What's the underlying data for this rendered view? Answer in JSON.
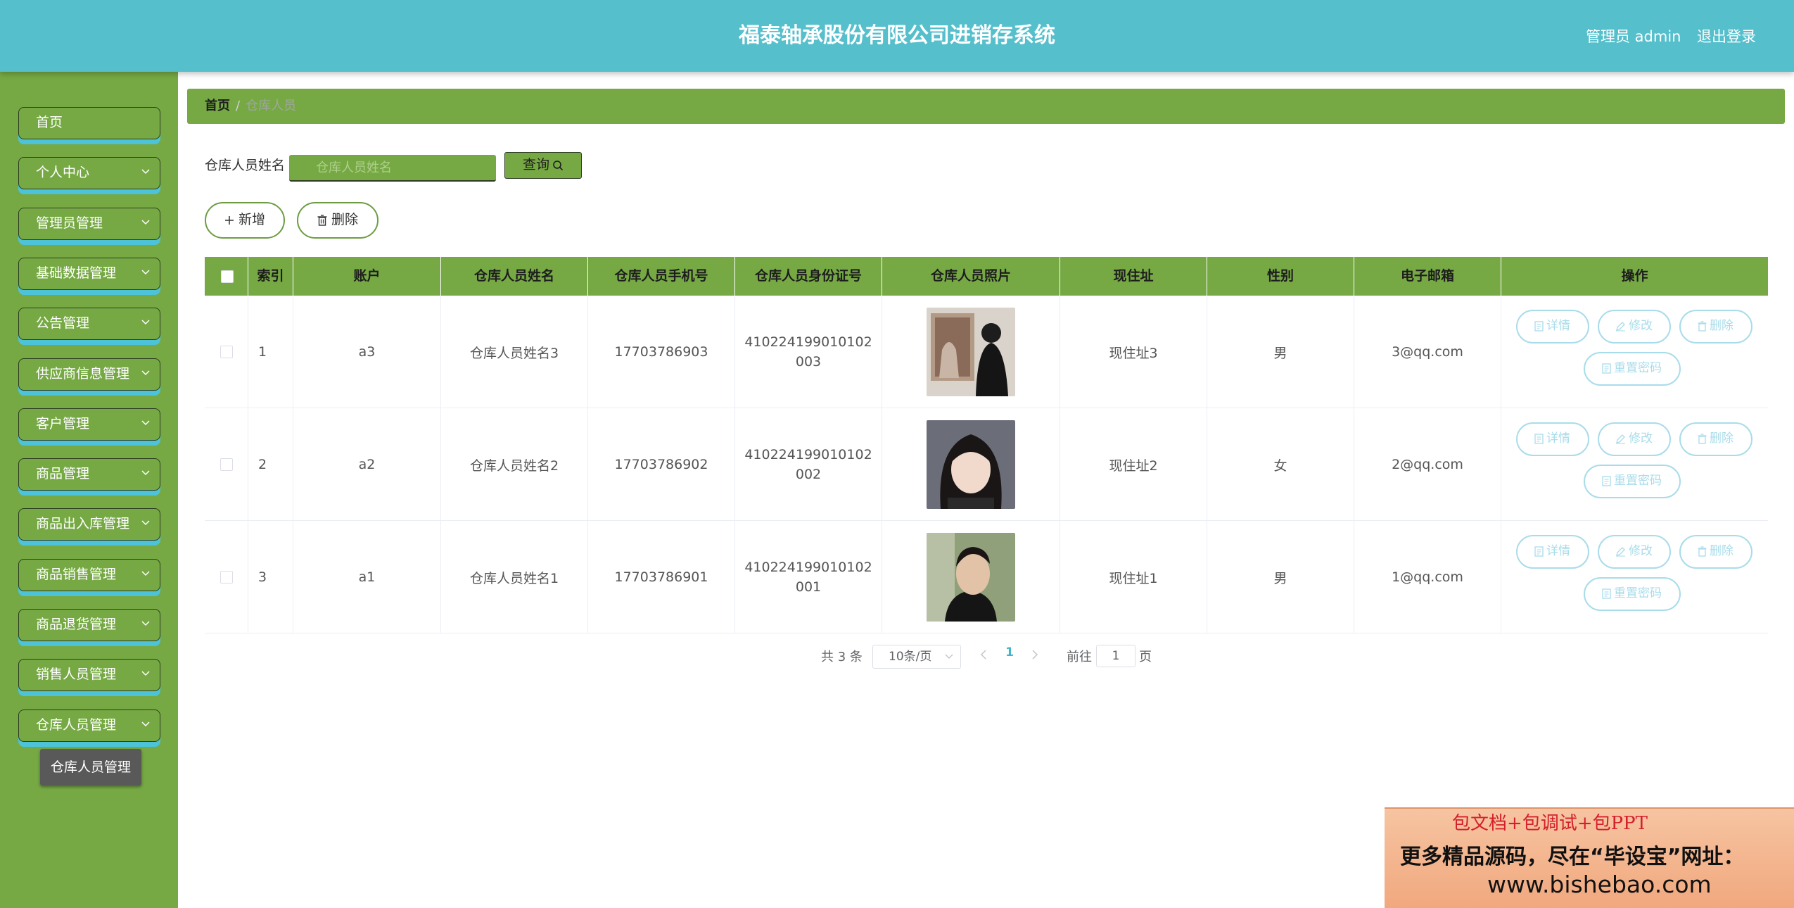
{
  "app": {
    "title": "福泰轴承股份有限公司进销存系统",
    "user_label": "管理员 admin",
    "logout_label": "退出登录"
  },
  "colors": {
    "header": "#55bfcc",
    "sidebar": "#76a944",
    "accent_shadow": "#4cc3d8",
    "op_button": "#a9dcea",
    "active_page": "#41b4c9"
  },
  "sidebar": {
    "items": [
      {
        "label": "首页",
        "has_chevron": false
      },
      {
        "label": "个人中心",
        "has_chevron": true
      },
      {
        "label": "管理员管理",
        "has_chevron": true
      },
      {
        "label": "基础数据管理",
        "has_chevron": true
      },
      {
        "label": "公告管理",
        "has_chevron": true
      },
      {
        "label": "供应商信息管理",
        "has_chevron": true
      },
      {
        "label": "客户管理",
        "has_chevron": true
      },
      {
        "label": "商品管理",
        "has_chevron": true
      },
      {
        "label": "商品出入库管理",
        "has_chevron": true
      },
      {
        "label": "商品销售管理",
        "has_chevron": true
      },
      {
        "label": "商品退货管理",
        "has_chevron": true
      },
      {
        "label": "销售人员管理",
        "has_chevron": true
      },
      {
        "label": "仓库人员管理",
        "has_chevron": true
      }
    ],
    "active_sub_item": "仓库人员管理"
  },
  "breadcrumb": {
    "home": "首页",
    "separator": "/",
    "current": "仓库人员"
  },
  "search": {
    "label": "仓库人员姓名",
    "placeholder": "仓库人员姓名",
    "button_label": "查询"
  },
  "actions": {
    "add_label": "新增",
    "delete_label": "删除"
  },
  "table": {
    "columns": [
      "索引",
      "账户",
      "仓库人员姓名",
      "仓库人员手机号",
      "仓库人员身份证号",
      "仓库人员照片",
      "现住址",
      "性别",
      "电子邮箱",
      "操作"
    ],
    "rows": [
      {
        "index": "1",
        "account": "a3",
        "name": "仓库人员姓名3",
        "phone": "17703786903",
        "id_card": "410224199010102003",
        "photo": "photo-person-back",
        "address": "现住址3",
        "gender": "男",
        "email": "3@qq.com"
      },
      {
        "index": "2",
        "account": "a2",
        "name": "仓库人员姓名2",
        "phone": "17703786902",
        "id_card": "410224199010102002",
        "photo": "photo-woman-portrait",
        "address": "现住址2",
        "gender": "女",
        "email": "2@qq.com"
      },
      {
        "index": "3",
        "account": "a1",
        "name": "仓库人员姓名1",
        "phone": "17703786901",
        "id_card": "410224199010102001",
        "photo": "photo-man-portrait",
        "address": "现住址1",
        "gender": "男",
        "email": "1@qq.com"
      }
    ],
    "row_actions": {
      "detail": "详情",
      "edit": "修改",
      "delete": "删除",
      "reset_password": "重置密码"
    }
  },
  "pagination": {
    "total": "共 3 条",
    "page_size": "10条/页",
    "current_page": "1",
    "goto_label": "前往",
    "goto_value": "1",
    "page_suffix": "页"
  },
  "promo": {
    "line1": "包文档+包调试+包PPT",
    "line2": "更多精品源码，尽在“毕设宝”网址：",
    "line3": "www.bishebao.com"
  }
}
